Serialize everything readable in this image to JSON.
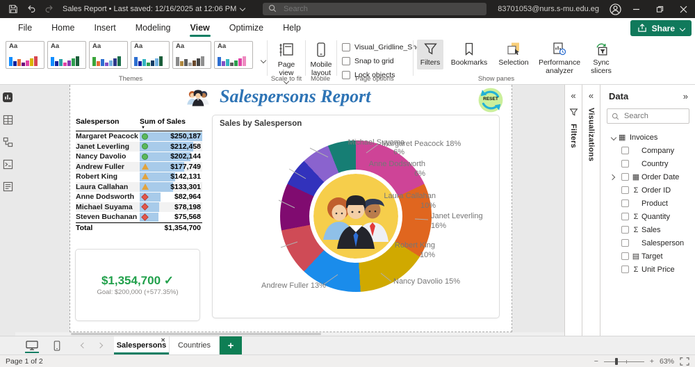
{
  "titlebar": {
    "title": "Sales Report • Last saved: 12/16/2025 at 12:06 PM",
    "search_placeholder": "Search",
    "account": "83701053@nurs.s-mu.edu.eg"
  },
  "ribbon": {
    "tabs": [
      "File",
      "Home",
      "Insert",
      "Modeling",
      "View",
      "Optimize",
      "Help"
    ],
    "active_tab": "View",
    "share_label": "Share",
    "theme_sample_text": "Aa",
    "themes_gallery": [
      [
        "#118DFF",
        "#12239E",
        "#E66C37",
        "#6B007B",
        "#E044A7",
        "#D9B300",
        "#D64550"
      ],
      [
        "#118DFF",
        "#12239E",
        "#2AA0A4",
        "#E044A7",
        "#8A3AB5",
        "#2E9E4F",
        "#1B5E3A"
      ],
      [
        "#3AA53A",
        "#E66C37",
        "#2D6FD1",
        "#8250C4",
        "#74B3E3",
        "#2E3A8C",
        "#1B6E4A"
      ],
      [
        "#2D6FD1",
        "#12239E",
        "#35B5C1",
        "#2E9E4F",
        "#123A63",
        "#74B3E3",
        "#1B5E3A"
      ],
      [
        "#8A8A8A",
        "#B0883F",
        "#5C5C5C",
        "#A3A3A3",
        "#6B4A2D",
        "#444444",
        "#8F8F8F"
      ],
      [
        "#2D6FD1",
        "#8250C4",
        "#35B5C1",
        "#5C5C5C",
        "#2E9E4F",
        "#E044A7",
        "#EE8AC0"
      ]
    ],
    "buttons": {
      "page_view": "Page view",
      "mobile_layout": "Mobile layout",
      "filters": "Filters",
      "bookmarks": "Bookmarks",
      "selection": "Selection",
      "performance_analyzer": "Performance analyzer",
      "sync_slicers": "Sync slicers"
    },
    "page_options": [
      "Visual_Gridline_Show",
      "Snap to grid",
      "Lock objects"
    ],
    "group_labels": {
      "themes": "Themes",
      "scale_to_fit": "Scale to fit",
      "mobile": "Mobile",
      "page_options": "Page options",
      "show_panes": "Show panes"
    }
  },
  "report": {
    "title": "Salespersons Report",
    "reset_label": "RESET",
    "table": {
      "headers": [
        "Salesperson",
        "Sum of Sales"
      ],
      "rows": [
        {
          "name": "Margaret Peacock",
          "icon": "circle",
          "value": "$250,187",
          "bar_pct": 100
        },
        {
          "name": "Janet Leverling",
          "icon": "circle",
          "value": "$212,458",
          "bar_pct": 85
        },
        {
          "name": "Nancy Davolio",
          "icon": "circle",
          "value": "$202,144",
          "bar_pct": 81
        },
        {
          "name": "Andrew Fuller",
          "icon": "triangle",
          "value": "$177,749",
          "bar_pct": 71
        },
        {
          "name": "Robert King",
          "icon": "triangle",
          "value": "$142,131",
          "bar_pct": 57
        },
        {
          "name": "Laura Callahan",
          "icon": "triangle",
          "value": "$133,301",
          "bar_pct": 53
        },
        {
          "name": "Anne Dodsworth",
          "icon": "diamond",
          "value": "$82,964",
          "bar_pct": 33
        },
        {
          "name": "Michael Suyama",
          "icon": "diamond",
          "value": "$78,198",
          "bar_pct": 31
        },
        {
          "name": "Steven Buchanan",
          "icon": "diamond",
          "value": "$75,568",
          "bar_pct": 30
        }
      ],
      "total_label": "Total",
      "total_value": "$1,354,700"
    },
    "kpi": {
      "value": "$1,354,700",
      "check": "✓",
      "goal": "Goal: $200,000 (+577.35%)"
    },
    "pie_title": "Sales by Salesperson"
  },
  "chart_data": {
    "type": "pie",
    "title": "Sales by Salesperson",
    "donut": true,
    "center_illustration": "cartoon of three salespeople on a yellow circle",
    "slices": [
      {
        "label": "Margaret Peacock",
        "pct": 18,
        "sales": 250187,
        "color": "#CE4497",
        "labeled": true
      },
      {
        "label": "Janet Leverling",
        "pct": 16,
        "sales": 212458,
        "color": "#E0661F",
        "labeled": true
      },
      {
        "label": "Nancy Davolio",
        "pct": 15,
        "sales": 202144,
        "color": "#D0A900",
        "labeled": true
      },
      {
        "label": "Andrew Fuller",
        "pct": 13,
        "sales": 177749,
        "color": "#1A8CEB",
        "labeled": true
      },
      {
        "label": "Robert King",
        "pct": 10,
        "sales": 142131,
        "color": "#CF4B56",
        "labeled": true
      },
      {
        "label": "Laura Callahan",
        "pct": 10,
        "sales": 133301,
        "color": "#800B70",
        "labeled": true
      },
      {
        "label": "Anne Dodsworth",
        "pct": 6,
        "sales": 82964,
        "color": "#3232BC",
        "labeled": true
      },
      {
        "label": "Michael Suyama",
        "pct": 6,
        "sales": 78198,
        "color": "#8A63CE",
        "labeled": true
      },
      {
        "label": "Steven Buchanan",
        "pct": 6,
        "sales": 75568,
        "color": "#167E74",
        "labeled": false
      }
    ]
  },
  "panes": {
    "filters_title": "Filters",
    "visualizations_title": "Visualizations",
    "data": {
      "title": "Data",
      "search_placeholder": "Search",
      "table": {
        "name": "Invoices",
        "fields": [
          {
            "label": "Company",
            "icon": "none",
            "expandable": false
          },
          {
            "label": "Country",
            "icon": "none",
            "expandable": false
          },
          {
            "label": "Order Date",
            "icon": "date",
            "expandable": true
          },
          {
            "label": "Order ID",
            "icon": "sigma",
            "expandable": false
          },
          {
            "label": "Product",
            "icon": "none",
            "expandable": false
          },
          {
            "label": "Quantity",
            "icon": "sigma",
            "expandable": false
          },
          {
            "label": "Sales",
            "icon": "sigma",
            "expandable": false
          },
          {
            "label": "Salesperson",
            "icon": "none",
            "expandable": false
          },
          {
            "label": "Target",
            "icon": "target",
            "expandable": false
          },
          {
            "label": "Unit Price",
            "icon": "sigma",
            "expandable": false
          }
        ]
      }
    }
  },
  "pages": {
    "tabs": [
      {
        "label": "Salespersons",
        "active": true
      },
      {
        "label": "Countries",
        "active": false
      }
    ],
    "add_label": "+"
  },
  "statusbar": {
    "page_indicator": "Page 1 of 2",
    "zoom_level": "63%",
    "zoom_out": "−",
    "zoom_in": "+"
  }
}
